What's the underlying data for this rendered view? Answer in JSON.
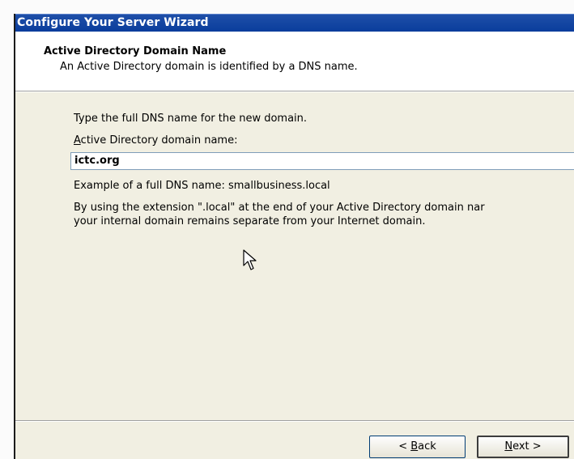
{
  "window": {
    "title": "Configure Your Server Wizard"
  },
  "header": {
    "title": "Active Directory Domain Name",
    "subtitle": "An Active Directory domain is identified by a DNS name."
  },
  "content": {
    "instruction": "Type the full DNS name for the new domain.",
    "field_label_prefix": "A",
    "field_label_rest": "ctive Directory domain name:",
    "domain_value": "ictc.org",
    "example": "Example of a full DNS name: smallbusiness.local",
    "note_line1": "By using the extension \".local\" at the end of your Active Directory domain nar",
    "note_line2": "your internal domain remains separate from your Internet domain."
  },
  "buttons": {
    "back_prefix": "< ",
    "back_underlined": "B",
    "back_rest": "ack",
    "next_underlined": "N",
    "next_rest": "ext >"
  },
  "icons": {
    "cursor": "mouse-pointer-icon"
  }
}
